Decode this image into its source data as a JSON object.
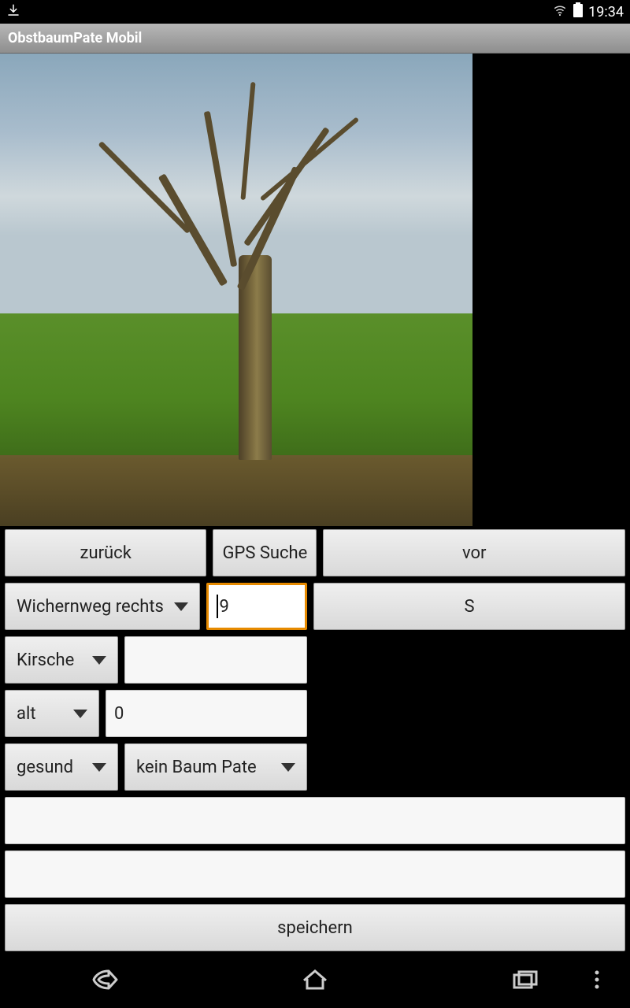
{
  "status": {
    "time": "19:34"
  },
  "app": {
    "title": "ObstbaumPate Mobil"
  },
  "nav": {
    "back_label": "zurück",
    "gps_label": "GPS Suche",
    "forward_label": "vor"
  },
  "row2": {
    "street_select": "Wichernweg rechts",
    "number_input": "9",
    "s_button_label": "S"
  },
  "row3": {
    "fruit_select": "Kirsche",
    "variety_input": ""
  },
  "row4": {
    "age_select": "alt",
    "age_value": "0"
  },
  "row5": {
    "health_select": "gesund",
    "sponsor_select": "kein Baum Pate"
  },
  "notes1": "",
  "notes2": "",
  "save_label": "speichern"
}
